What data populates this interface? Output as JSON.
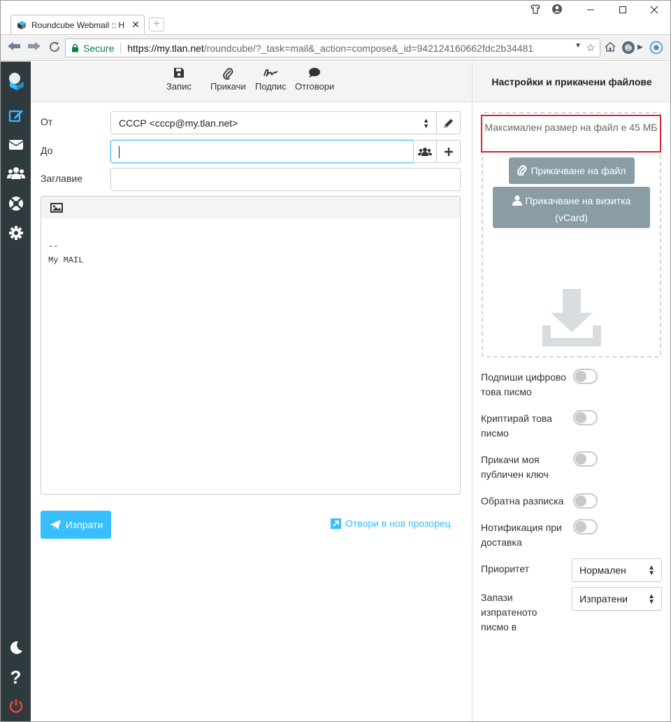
{
  "browser": {
    "tab_title": "Roundcube Webmail :: H",
    "tab_close": "✕",
    "new_tab": "+",
    "secure_label": "Secure",
    "url_host": "https://my.tlan.net",
    "url_path": "/roundcube/?_task=mail&_action=compose&_id=942124160662fdc2b34481"
  },
  "toolbar": {
    "save_label": "Запис",
    "attach_label": "Прикачи",
    "signature_label": "Подпис",
    "responses_label": "Отговори"
  },
  "form": {
    "from_label": "От",
    "from_value": "СССР <cccp@my.tlan.net>",
    "to_label": "До",
    "to_value": "",
    "subject_label": "Заглавие",
    "subject_value": "",
    "body_line1": "--",
    "body_line2": "My MAIL"
  },
  "actions": {
    "send_label": "Изпрати",
    "new_window_label": "Отвори в нов прозорец"
  },
  "panel": {
    "title": "Настройки и прикачени файлове",
    "max_size": "Максимален размер на файл е 45 МБ",
    "attach_file_label": "Прикачване на файл",
    "attach_vcard_label": "Прикачване на визитка (vCard)",
    "options": [
      {
        "label": "Подпиши цифрово това писмо",
        "enabled": false
      },
      {
        "label": "Криптирай това писмо",
        "enabled": false
      },
      {
        "label": "Прикачи моя публичен ключ",
        "enabled": false
      },
      {
        "label": "Обратна разписка",
        "enabled": false
      },
      {
        "label": "Нотификация при доставка",
        "enabled": false
      }
    ],
    "priority_label": "Приоритет",
    "priority_value": "Нормален",
    "save_sent_label": "Запази изпратеното писмо в",
    "save_sent_value": "Изпратени"
  },
  "colors": {
    "accent": "#37beff",
    "sidebar": "#2f3a3f",
    "highlight_border": "#d9232e",
    "button_gray": "#8a9ca4"
  }
}
